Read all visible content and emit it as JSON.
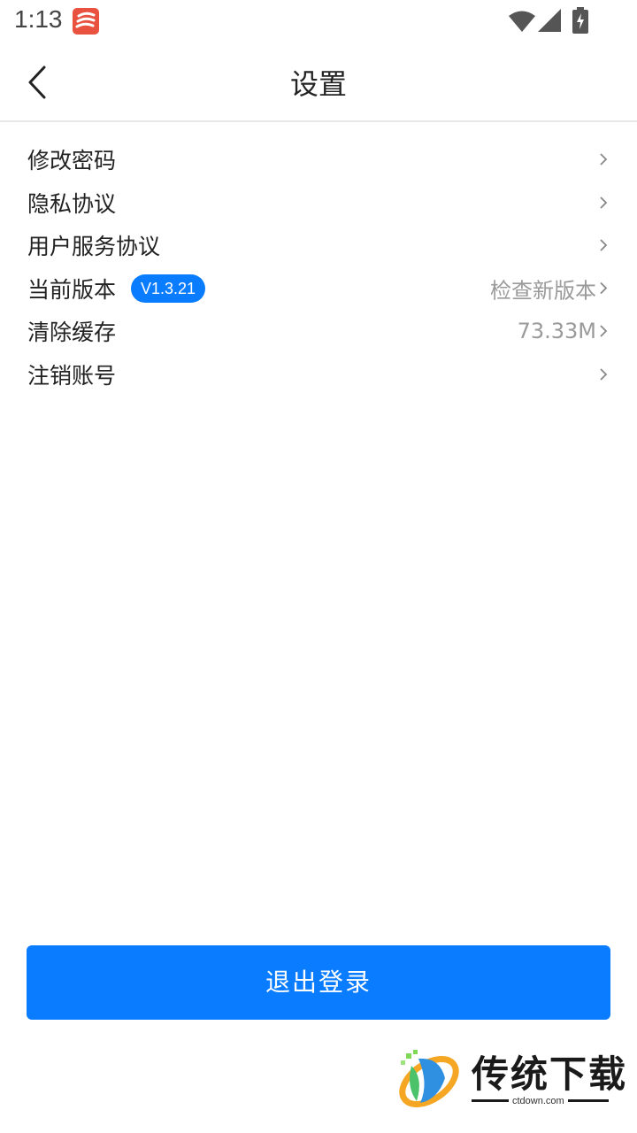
{
  "status_bar": {
    "time": "1:13"
  },
  "header": {
    "title": "设置"
  },
  "settings": {
    "items": [
      {
        "label": "修改密码",
        "value": ""
      },
      {
        "label": "隐私协议",
        "value": ""
      },
      {
        "label": "用户服务协议",
        "value": ""
      },
      {
        "label": "当前版本",
        "badge": "V1.3.21",
        "value": "检查新版本"
      },
      {
        "label": "清除缓存",
        "value": "73.33M"
      },
      {
        "label": "注销账号",
        "value": ""
      }
    ]
  },
  "logout_button": {
    "label": "退出登录"
  },
  "watermark": {
    "text": "传统下载",
    "url": "ctdown.com"
  },
  "colors": {
    "accent": "#0a7cff",
    "app_icon": "#e8523f",
    "secondary_text": "#9a9a9a"
  }
}
